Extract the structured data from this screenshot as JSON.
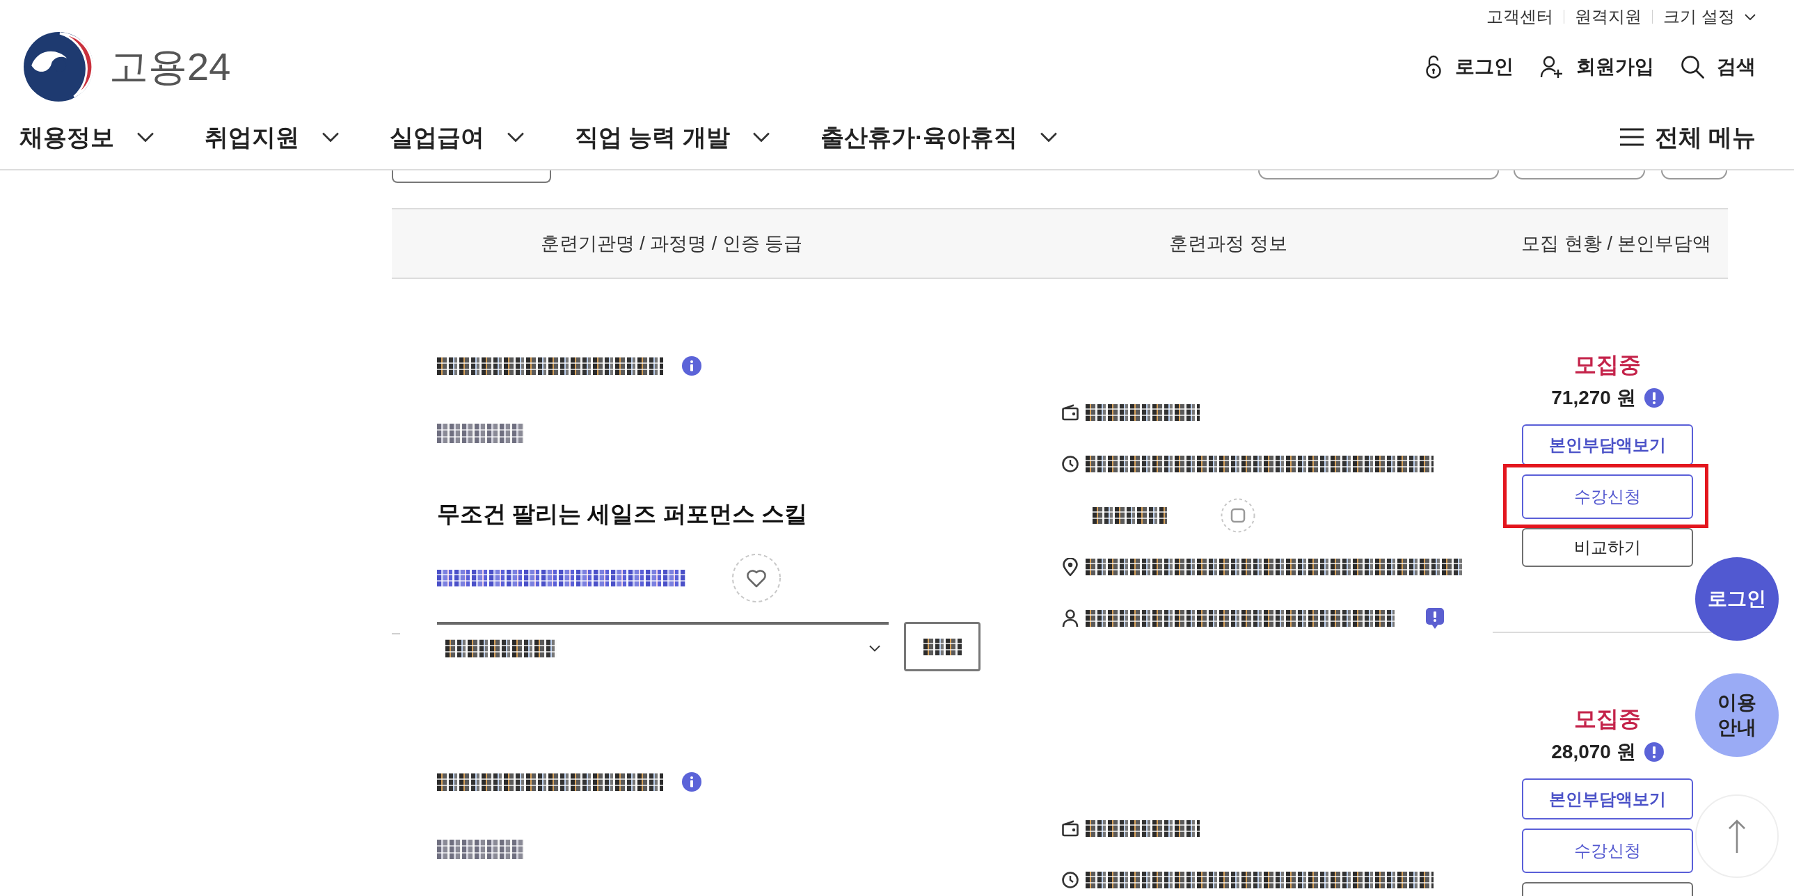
{
  "utility_links": [
    {
      "label": "고객센터",
      "kind": "link"
    },
    {
      "label": "원격지원",
      "kind": "link"
    },
    {
      "label": "크기 설정",
      "kind": "dropdown"
    }
  ],
  "logo": {
    "text": "고용24"
  },
  "account_links": [
    {
      "label": "로그인",
      "kind": "login"
    },
    {
      "label": "회원가입",
      "kind": "signup"
    },
    {
      "label": "검색",
      "kind": "search"
    }
  ],
  "nav": {
    "items": [
      {
        "label": "채용정보"
      },
      {
        "label": "취업지원"
      },
      {
        "label": "실업급여"
      },
      {
        "label": "직업 능력 개발"
      },
      {
        "label": "출산휴가·육아휴직"
      }
    ],
    "all_menu": "전체 메뉴"
  },
  "table": {
    "columns": [
      "훈련기관명 / 과정명 / 인증 등급",
      "훈련과정 정보",
      "모집 현황 / 본인부담액"
    ]
  },
  "courses": [
    {
      "sections": [
        {
          "kind": "institution"
        },
        {
          "kind": "certification"
        },
        {
          "kind": "title",
          "text": "무조건 팔리는 세일즈 퍼포먼스 스킬"
        },
        {
          "kind": "link",
          "favorite": false
        },
        {
          "kind": "select"
        }
      ],
      "info_rows": [
        {
          "kind": "cost"
        },
        {
          "kind": "period"
        },
        {
          "kind": "duration"
        },
        {
          "kind": "contact"
        },
        {
          "kind": "ncs"
        }
      ],
      "status": "모집중",
      "amount": "71,270 원",
      "buttons": [
        {
          "kind": "primary",
          "label": "본인부담액보기",
          "highlighted": false
        },
        {
          "kind": "secondary",
          "label": "수강신청",
          "highlighted": true
        },
        {
          "kind": "plain",
          "label": "비교하기",
          "highlighted": false
        }
      ]
    },
    {
      "sections": [
        {
          "kind": "institution"
        },
        {
          "kind": "certification"
        }
      ],
      "info_rows": [
        {
          "kind": "cost"
        },
        {
          "kind": "period"
        }
      ],
      "status": "모집중",
      "amount": "28,070 원",
      "buttons": [
        {
          "kind": "primary",
          "label": "본인부담액보기",
          "highlighted": false
        },
        {
          "kind": "secondary",
          "label": "수강신청",
          "highlighted": false
        },
        {
          "kind": "plain",
          "highlighted": false
        }
      ]
    }
  ],
  "floating_buttons": [
    {
      "kind": "login",
      "label": "로그인"
    },
    {
      "kind": "guide",
      "label": "이용 안내"
    },
    {
      "kind": "top"
    }
  ]
}
